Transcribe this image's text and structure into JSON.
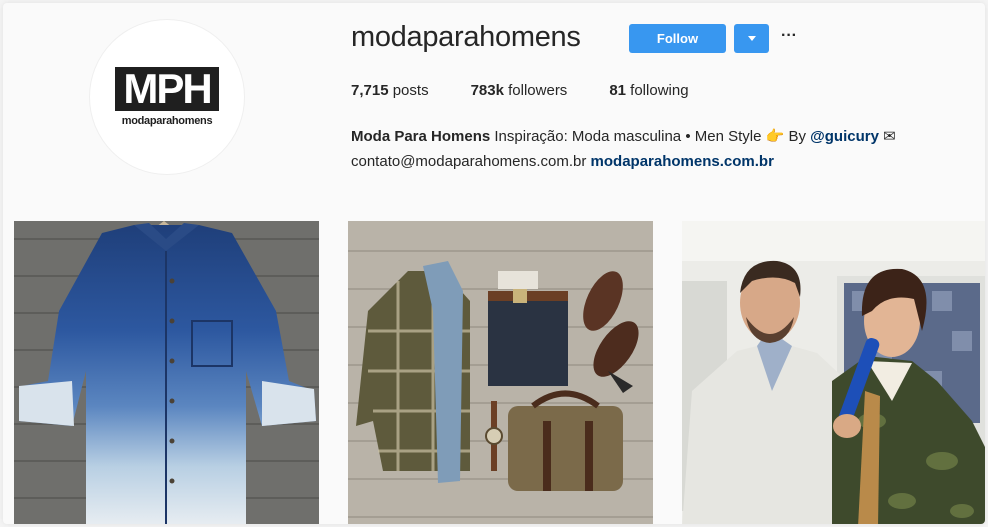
{
  "profile": {
    "avatar_logo": "MPH",
    "avatar_sub": "modaparahomens",
    "username": "modaparahomens",
    "follow_label": "Follow",
    "more_label": "···"
  },
  "stats": [
    {
      "value": "7,715",
      "label": "posts"
    },
    {
      "value": "783k",
      "label": "followers"
    },
    {
      "value": "81",
      "label": "following"
    }
  ],
  "bio": {
    "name": "Moda Para Homens",
    "text1": " Inspiração: Moda masculina • Men Style ",
    "hand_emoji": "👉",
    "text2": " By ",
    "mention": "@guicury",
    "envelope": " ✉",
    "email": "contato@modaparahomens.com.br ",
    "website": "modaparahomens.com.br"
  },
  "posts": [
    {
      "name": "post-1"
    },
    {
      "name": "post-2"
    },
    {
      "name": "post-3"
    }
  ],
  "colors": {
    "accent": "#3897f0",
    "link": "#003569"
  }
}
